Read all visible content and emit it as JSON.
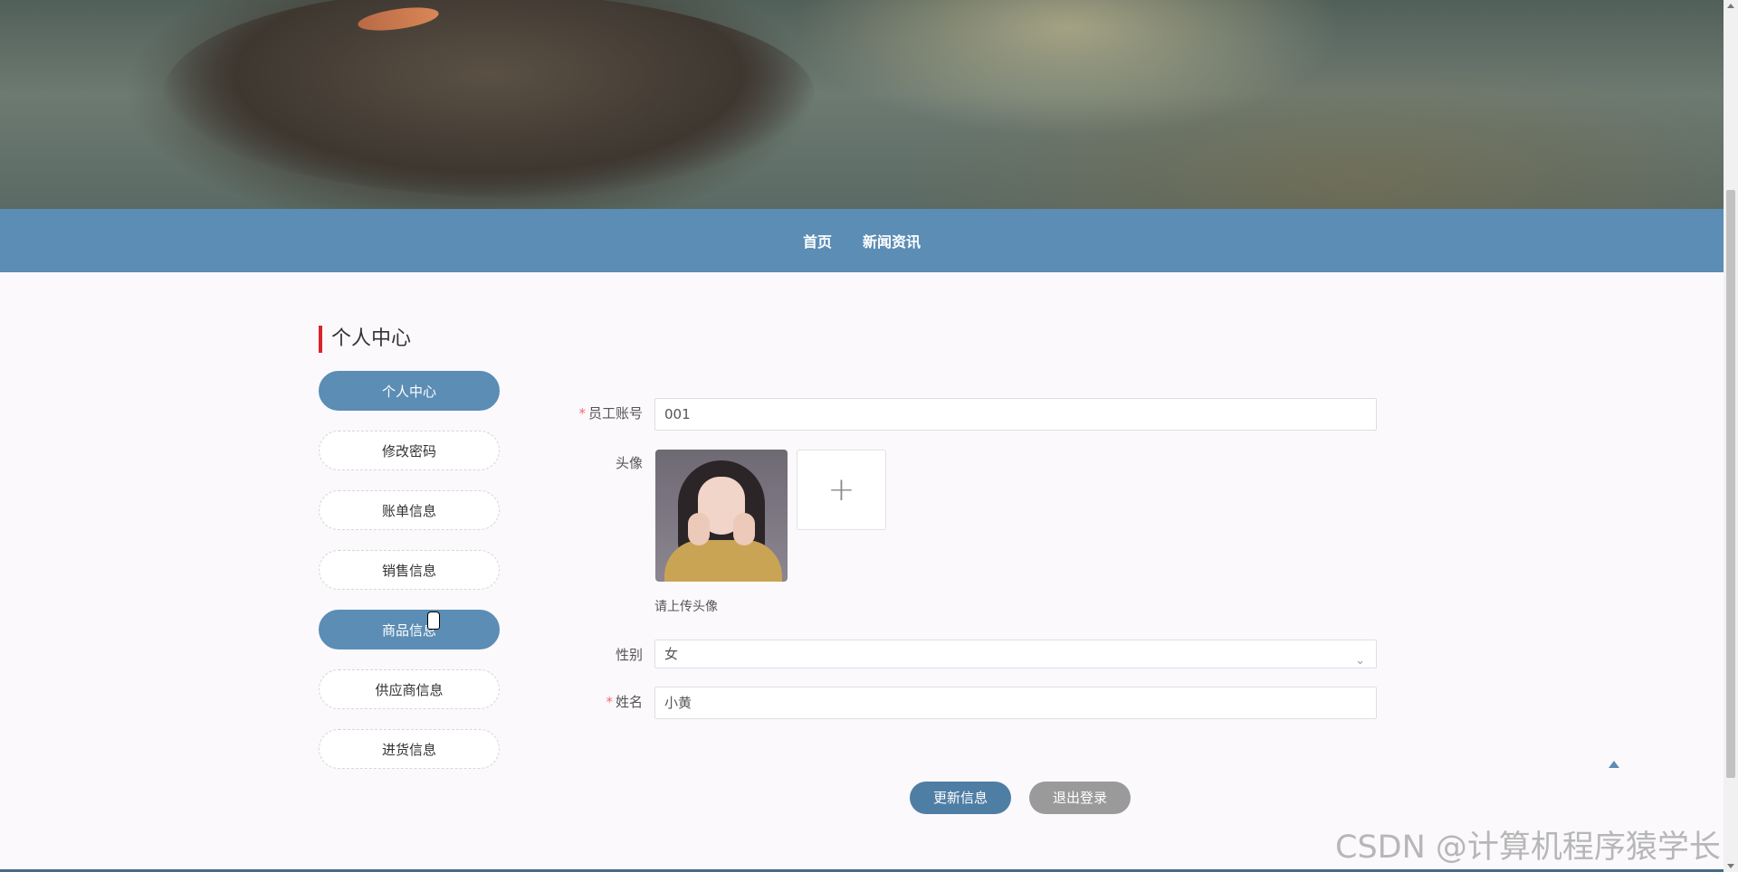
{
  "nav": {
    "items": [
      {
        "label": "首页"
      },
      {
        "label": "新闻资讯"
      }
    ]
  },
  "sidebar": {
    "title": "个人中心",
    "items": [
      {
        "label": "个人中心",
        "active": true
      },
      {
        "label": "修改密码",
        "active": false
      },
      {
        "label": "账单信息",
        "active": false
      },
      {
        "label": "销售信息",
        "active": false
      },
      {
        "label": "商品信息",
        "active": true
      },
      {
        "label": "供应商信息",
        "active": false
      },
      {
        "label": "进货信息",
        "active": false
      }
    ]
  },
  "form": {
    "account_label": "员工账号",
    "account_value": "001",
    "avatar_label": "头像",
    "avatar_hint": "请上传头像",
    "upload_symbol": "+",
    "gender_label": "性别",
    "gender_value": "女",
    "name_label": "姓名",
    "name_value": "小黄",
    "required_mark": "*"
  },
  "actions": {
    "update_label": "更新信息",
    "logout_label": "退出登录"
  },
  "watermark": "CSDN @计算机程序猿学长",
  "colors": {
    "accent": "#5b8db5",
    "required": "#f56c6c",
    "title_bar": "#d9232d"
  }
}
